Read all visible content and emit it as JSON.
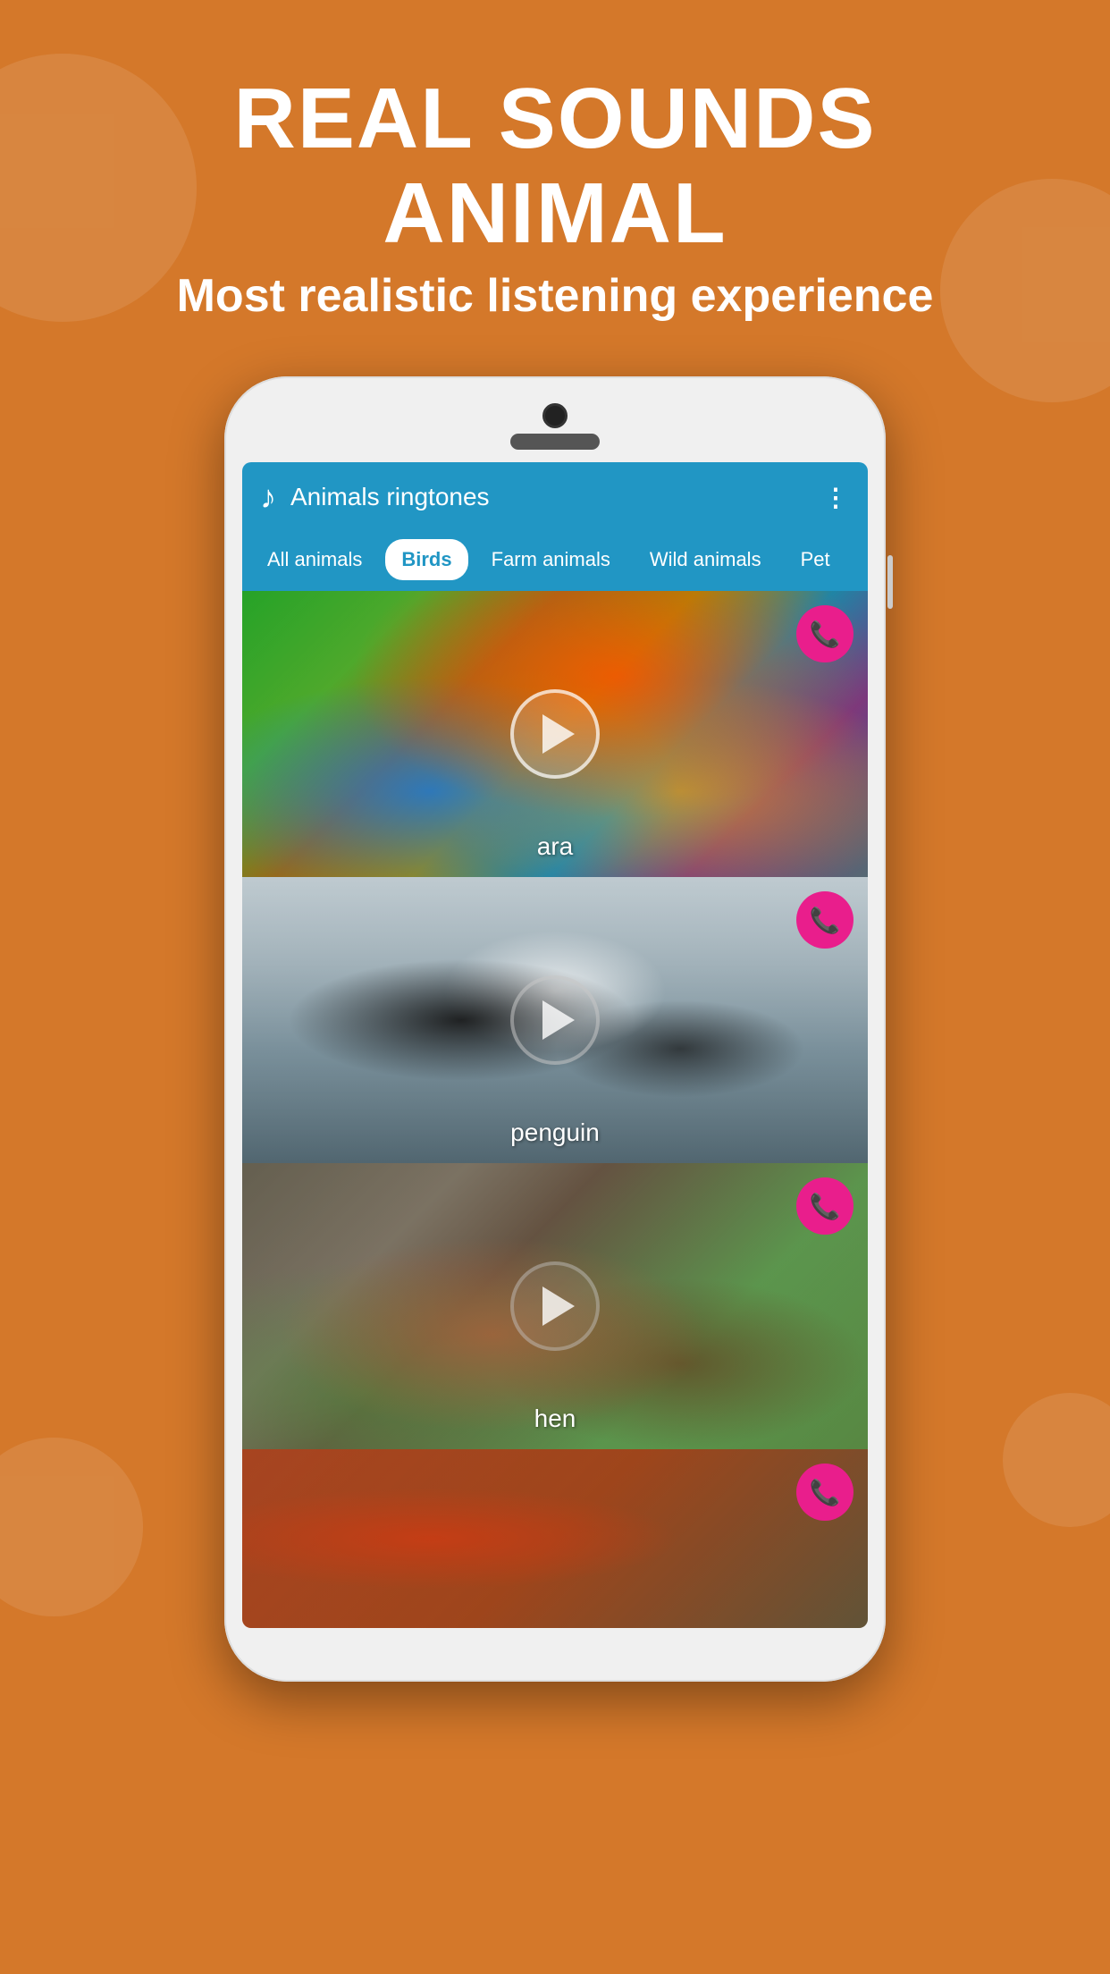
{
  "header": {
    "main_title": "REAL SOUNDS ANIMAL",
    "sub_title": "Most realistic listening experience"
  },
  "app_bar": {
    "title": "Animals ringtones",
    "music_icon": "♪",
    "more_icon": "⋮"
  },
  "tabs": [
    {
      "label": "All animals",
      "active": false
    },
    {
      "label": "Birds",
      "active": true
    },
    {
      "label": "Farm animals",
      "active": false
    },
    {
      "label": "Wild animals",
      "active": false
    },
    {
      "label": "Pet",
      "active": false
    }
  ],
  "animals": [
    {
      "name": "ara",
      "image_type": "parrot"
    },
    {
      "name": "penguin",
      "image_type": "penguin"
    },
    {
      "name": "hen",
      "image_type": "hen"
    },
    {
      "name": "",
      "image_type": "partial"
    }
  ],
  "icons": {
    "play": "▶",
    "phone": "📞",
    "music_note": "♪"
  }
}
